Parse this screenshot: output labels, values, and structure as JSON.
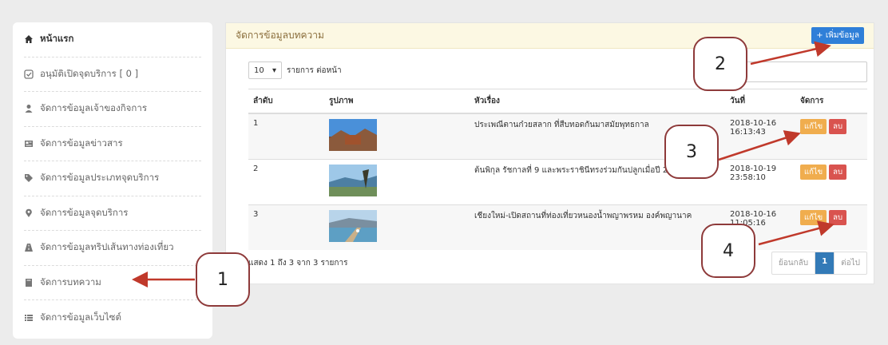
{
  "sidebar": {
    "items": [
      {
        "label": "หน้าแรก",
        "icon": "home-icon"
      },
      {
        "label": "อนุมัติเปิดจุดบริการ [ 0 ]",
        "icon": "check-square-icon"
      },
      {
        "label": "จัดการข้อมูลเจ้าของกิจการ",
        "icon": "user-icon"
      },
      {
        "label": "จัดการข้อมูลข่าวสาร",
        "icon": "news-icon"
      },
      {
        "label": "จัดการข้อมูลประเภทจุดบริการ",
        "icon": "tags-icon"
      },
      {
        "label": "จัดการข้อมูลจุดบริการ",
        "icon": "map-marker-icon"
      },
      {
        "label": "จัดการข้อมูลทริปเส้นทางท่องเที่ยว",
        "icon": "road-icon"
      },
      {
        "label": "จัดการบทความ",
        "icon": "book-icon"
      },
      {
        "label": "จัดการข้อมูลเว็บไซต์",
        "icon": "list-icon"
      }
    ]
  },
  "panel": {
    "title": "จัดการข้อมูลบทความ",
    "add_label": "+ เพิ่มข้อมูล",
    "length_value": "10",
    "length_caret": "▾",
    "length_text": "รายการ ต่อหน้า",
    "columns": [
      "ลำดับ",
      "รูปภาพ",
      "หัวเรื่อง",
      "วันที่",
      "จัดการ"
    ],
    "rows": [
      {
        "no": "1",
        "title": "ประเพณีตานก๋วยสลาก ที่สืบทอดกันมาสมัยพุทธกาล",
        "date": "2018-10-16",
        "time": "16:13:43"
      },
      {
        "no": "2",
        "title": "ต้นพิกุล รัชกาลที่ 9 และพระราชินีทรงร่วมกันปลูกเมื่อปี 2525",
        "date": "2018-10-19",
        "time": "23:58:10"
      },
      {
        "no": "3",
        "title": "เชียงใหม่-เปิดสถานที่ท่องเที่ยวหนองน้ำพญาพรหม องค์พญานาค",
        "date": "2018-10-16",
        "time": "11:05:16"
      }
    ],
    "edit_label": "แก้ไข",
    "delete_label": "ลบ",
    "info": "แสดง 1 ถึง 3 จาก 3 รายการ",
    "pager": {
      "prev": "ย้อนกลับ",
      "page": "1",
      "next": "ต่อไป"
    }
  },
  "callouts": [
    "1",
    "2",
    "3",
    "4"
  ],
  "colors": {
    "accent": "#2f7fd8",
    "edit": "#f0ad4e",
    "delete": "#d9534f",
    "arrow": "#c0392b",
    "panel_head": "#fcf8e3"
  }
}
